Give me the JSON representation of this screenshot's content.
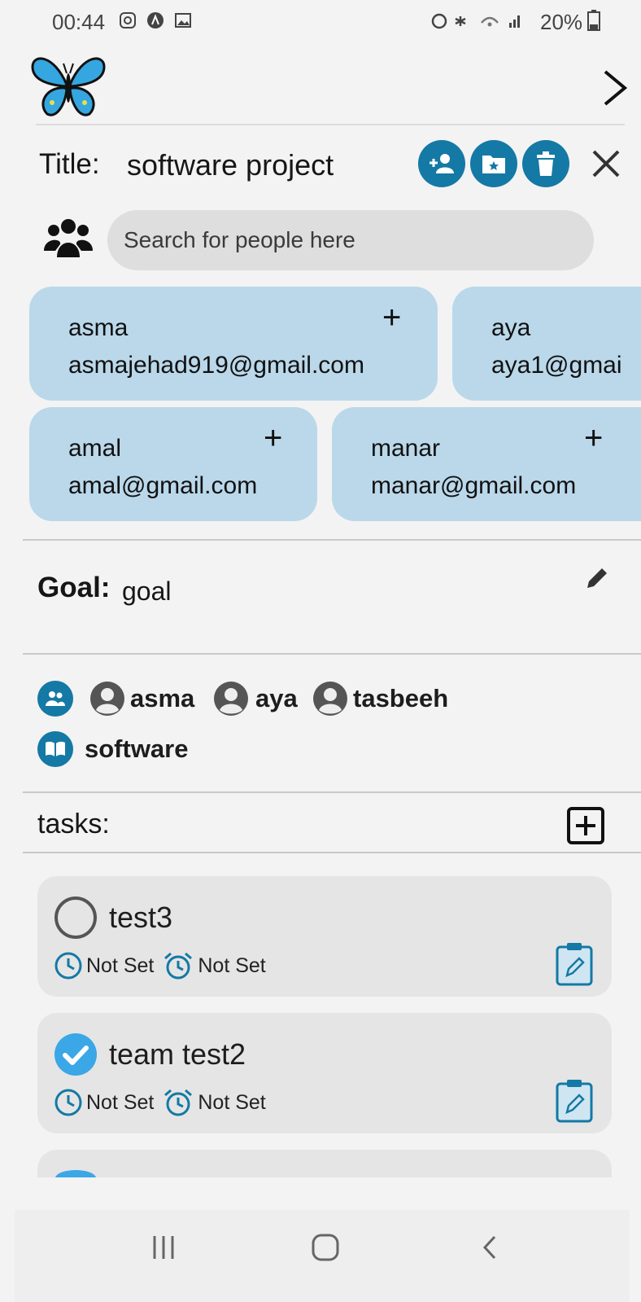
{
  "status_bar": {
    "time": "00:44",
    "right_text": "20%",
    "icons_left": [
      "instagram-icon",
      "app-a-icon",
      "image-icon"
    ],
    "icons_right": [
      "alarm-icon",
      "mute-icon",
      "wifi-icon",
      "signal-icon",
      "battery-icon"
    ]
  },
  "header": {
    "logo": "butterfly-logo",
    "next_icon": "chevron-right-icon"
  },
  "project": {
    "title_label": "Title:",
    "title_value": "software project",
    "actions": [
      "add-person-icon",
      "folder-star-icon",
      "trash-icon",
      "close-icon"
    ]
  },
  "search": {
    "placeholder": "Search for people here"
  },
  "people_results": [
    {
      "name": "asma",
      "email": "asmajehad919@gmail.com",
      "action": "+"
    },
    {
      "name": "aya",
      "email": "aya1@gmai",
      "action": "+"
    },
    {
      "name": "amal",
      "email": "amal@gmail.com",
      "action": "+"
    },
    {
      "name": "manar",
      "email": "manar@gmail.com",
      "action": "+"
    }
  ],
  "goal": {
    "label": "Goal:",
    "value": "goal"
  },
  "members": {
    "people": [
      "asma",
      "aya",
      "tasbeeh"
    ],
    "category": "software"
  },
  "tasks": {
    "label": "tasks:",
    "items": [
      {
        "name": "test3",
        "done": false,
        "time": "Not Set",
        "alarm": "Not Set"
      },
      {
        "name": "team test2",
        "done": true,
        "time": "Not Set",
        "alarm": "Not Set"
      }
    ]
  },
  "colors": {
    "accent": "#1479a5",
    "card_blue": "#bad8ea",
    "check_blue": "#3ba7e6",
    "task_bg": "#e5e5e5"
  },
  "navbar": {
    "icons": [
      "recent-apps-icon",
      "home-icon",
      "back-icon"
    ]
  }
}
